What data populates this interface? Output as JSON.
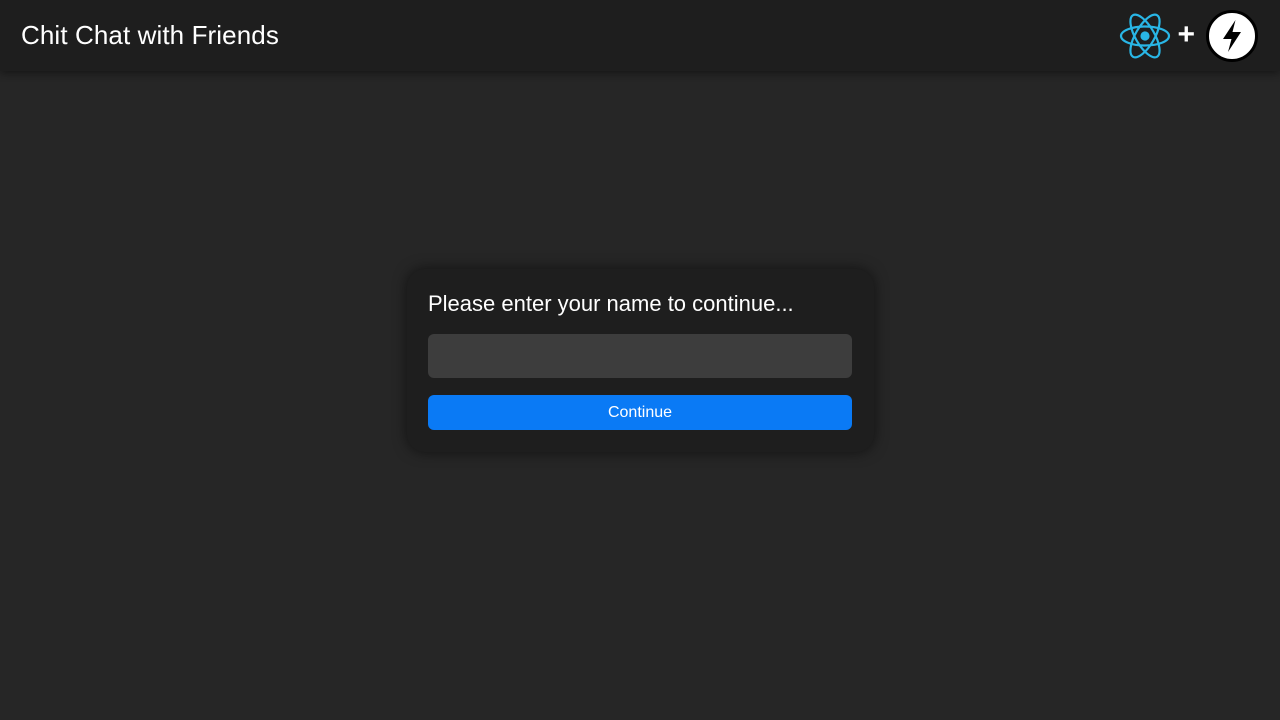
{
  "header": {
    "title": "Chit Chat with Friends",
    "plus": "+",
    "react_logo_icon": "react-logo-icon",
    "bolt_logo_icon": "lightning-bolt-logo-icon",
    "react_color": "#29b6e6"
  },
  "login": {
    "prompt": "Please enter your name to continue...",
    "name_input": {
      "value": "",
      "placeholder": ""
    },
    "continue_label": "Continue",
    "button_color": "#0a7af5"
  }
}
